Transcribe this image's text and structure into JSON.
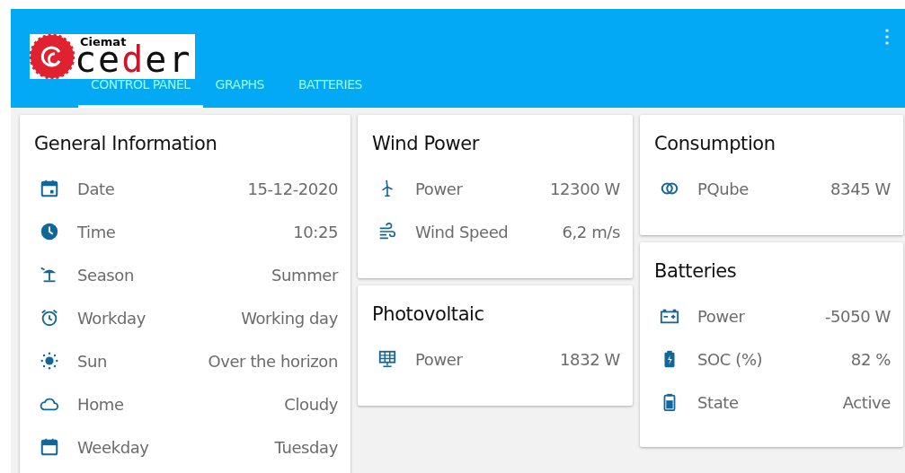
{
  "header": {
    "logo": {
      "small_text": "Ciemat",
      "large_text": "ceder"
    },
    "tabs": [
      {
        "label": "CONTROL PANEL",
        "selected": true
      },
      {
        "label": "GRAPHS",
        "selected": false
      },
      {
        "label": "BATTERIES",
        "selected": false
      }
    ],
    "menu_icon": "⋮"
  },
  "columns": [
    [
      {
        "title": "General Information",
        "rows": [
          {
            "kind": "calendar",
            "label": "Date",
            "value": "15-12-2020"
          },
          {
            "kind": "clock",
            "label": "Time",
            "value": "10:25"
          },
          {
            "kind": "umbrella",
            "label": "Season",
            "value": "Summer"
          },
          {
            "kind": "alarm",
            "label": "Workday",
            "value": "Working day"
          },
          {
            "kind": "sun",
            "label": "Sun",
            "value": "Over the horizon"
          },
          {
            "kind": "cloud",
            "label": "Home",
            "value": "Cloudy"
          },
          {
            "kind": "weekday",
            "label": "Weekday",
            "value": "Tuesday"
          }
        ]
      }
    ],
    [
      {
        "title": "Wind Power",
        "rows": [
          {
            "kind": "turbine",
            "label": "Power",
            "value": "12300 W"
          },
          {
            "kind": "wind",
            "label": "Wind Speed",
            "value": "6,2 m/s"
          }
        ]
      },
      {
        "title": "Photovoltaic",
        "rows": [
          {
            "kind": "solar",
            "label": "Power",
            "value": "1832 W"
          }
        ]
      }
    ],
    [
      {
        "title": "Consumption",
        "rows": [
          {
            "kind": "rings",
            "label": "PQube",
            "value": "8345 W"
          }
        ]
      },
      {
        "title": "Batteries",
        "rows": [
          {
            "kind": "accumulator",
            "label": "Power",
            "value": "-5050 W"
          },
          {
            "kind": "charging",
            "label": "SOC (%)",
            "value": "82 %"
          },
          {
            "kind": "battery",
            "label": "State",
            "value": "Active"
          }
        ]
      }
    ]
  ]
}
